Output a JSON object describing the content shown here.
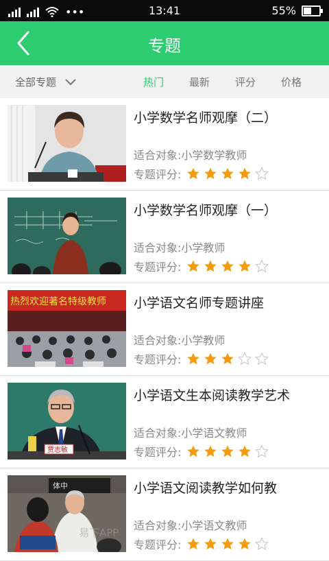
{
  "status": {
    "time": "13:41",
    "battery": "55%",
    "battery_level": 0.55
  },
  "header": {
    "title": "专题"
  },
  "filters": {
    "all": "全部专题",
    "sorts": [
      "热门",
      "最新",
      "评分",
      "价格"
    ],
    "active_sort": "热门"
  },
  "rating_label": "专题评分:",
  "items": [
    {
      "title": "小学数学名师观摩（二）",
      "target": "适合对象:小学数学教师",
      "rating": 4
    },
    {
      "title": "小学数学名师观摩（一）",
      "target": "适合对象:小学教师",
      "rating": 4
    },
    {
      "title": "小学语文名师专题讲座",
      "target": "适合对象:小学教师",
      "rating": 3
    },
    {
      "title": "小学语文生本阅读教学艺术",
      "target": "适合对象:小学语文教师",
      "rating": 4
    },
    {
      "title": "小学语文阅读教学如何教",
      "target": "适合对象:小学语文教师",
      "rating": 4
    }
  ],
  "thumb_texts": {
    "banner": "热烈欢迎著名特级教师",
    "nameplate": "贾志敏",
    "plaque": "体中"
  },
  "colors": {
    "accent": "#2ecc71",
    "star": "#f39c12",
    "star_empty": "#cccccc"
  },
  "watermark": "易下APP"
}
